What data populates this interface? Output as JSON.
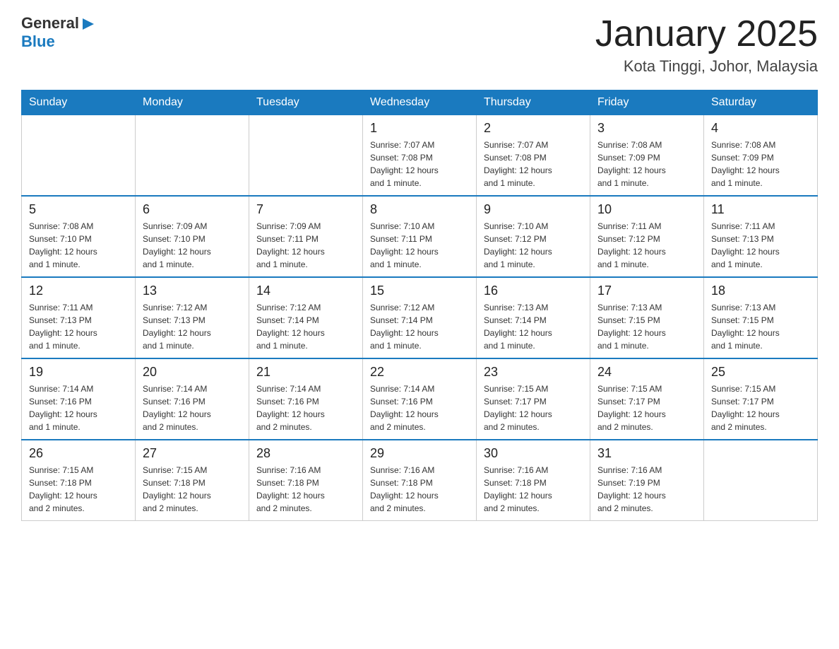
{
  "header": {
    "logo_general": "General",
    "logo_blue": "Blue",
    "title": "January 2025",
    "subtitle": "Kota Tinggi, Johor, Malaysia"
  },
  "columns": [
    "Sunday",
    "Monday",
    "Tuesday",
    "Wednesday",
    "Thursday",
    "Friday",
    "Saturday"
  ],
  "weeks": [
    [
      {
        "day": "",
        "info": ""
      },
      {
        "day": "",
        "info": ""
      },
      {
        "day": "",
        "info": ""
      },
      {
        "day": "1",
        "info": "Sunrise: 7:07 AM\nSunset: 7:08 PM\nDaylight: 12 hours\nand 1 minute."
      },
      {
        "day": "2",
        "info": "Sunrise: 7:07 AM\nSunset: 7:08 PM\nDaylight: 12 hours\nand 1 minute."
      },
      {
        "day": "3",
        "info": "Sunrise: 7:08 AM\nSunset: 7:09 PM\nDaylight: 12 hours\nand 1 minute."
      },
      {
        "day": "4",
        "info": "Sunrise: 7:08 AM\nSunset: 7:09 PM\nDaylight: 12 hours\nand 1 minute."
      }
    ],
    [
      {
        "day": "5",
        "info": "Sunrise: 7:08 AM\nSunset: 7:10 PM\nDaylight: 12 hours\nand 1 minute."
      },
      {
        "day": "6",
        "info": "Sunrise: 7:09 AM\nSunset: 7:10 PM\nDaylight: 12 hours\nand 1 minute."
      },
      {
        "day": "7",
        "info": "Sunrise: 7:09 AM\nSunset: 7:11 PM\nDaylight: 12 hours\nand 1 minute."
      },
      {
        "day": "8",
        "info": "Sunrise: 7:10 AM\nSunset: 7:11 PM\nDaylight: 12 hours\nand 1 minute."
      },
      {
        "day": "9",
        "info": "Sunrise: 7:10 AM\nSunset: 7:12 PM\nDaylight: 12 hours\nand 1 minute."
      },
      {
        "day": "10",
        "info": "Sunrise: 7:11 AM\nSunset: 7:12 PM\nDaylight: 12 hours\nand 1 minute."
      },
      {
        "day": "11",
        "info": "Sunrise: 7:11 AM\nSunset: 7:13 PM\nDaylight: 12 hours\nand 1 minute."
      }
    ],
    [
      {
        "day": "12",
        "info": "Sunrise: 7:11 AM\nSunset: 7:13 PM\nDaylight: 12 hours\nand 1 minute."
      },
      {
        "day": "13",
        "info": "Sunrise: 7:12 AM\nSunset: 7:13 PM\nDaylight: 12 hours\nand 1 minute."
      },
      {
        "day": "14",
        "info": "Sunrise: 7:12 AM\nSunset: 7:14 PM\nDaylight: 12 hours\nand 1 minute."
      },
      {
        "day": "15",
        "info": "Sunrise: 7:12 AM\nSunset: 7:14 PM\nDaylight: 12 hours\nand 1 minute."
      },
      {
        "day": "16",
        "info": "Sunrise: 7:13 AM\nSunset: 7:14 PM\nDaylight: 12 hours\nand 1 minute."
      },
      {
        "day": "17",
        "info": "Sunrise: 7:13 AM\nSunset: 7:15 PM\nDaylight: 12 hours\nand 1 minute."
      },
      {
        "day": "18",
        "info": "Sunrise: 7:13 AM\nSunset: 7:15 PM\nDaylight: 12 hours\nand 1 minute."
      }
    ],
    [
      {
        "day": "19",
        "info": "Sunrise: 7:14 AM\nSunset: 7:16 PM\nDaylight: 12 hours\nand 1 minute."
      },
      {
        "day": "20",
        "info": "Sunrise: 7:14 AM\nSunset: 7:16 PM\nDaylight: 12 hours\nand 2 minutes."
      },
      {
        "day": "21",
        "info": "Sunrise: 7:14 AM\nSunset: 7:16 PM\nDaylight: 12 hours\nand 2 minutes."
      },
      {
        "day": "22",
        "info": "Sunrise: 7:14 AM\nSunset: 7:16 PM\nDaylight: 12 hours\nand 2 minutes."
      },
      {
        "day": "23",
        "info": "Sunrise: 7:15 AM\nSunset: 7:17 PM\nDaylight: 12 hours\nand 2 minutes."
      },
      {
        "day": "24",
        "info": "Sunrise: 7:15 AM\nSunset: 7:17 PM\nDaylight: 12 hours\nand 2 minutes."
      },
      {
        "day": "25",
        "info": "Sunrise: 7:15 AM\nSunset: 7:17 PM\nDaylight: 12 hours\nand 2 minutes."
      }
    ],
    [
      {
        "day": "26",
        "info": "Sunrise: 7:15 AM\nSunset: 7:18 PM\nDaylight: 12 hours\nand 2 minutes."
      },
      {
        "day": "27",
        "info": "Sunrise: 7:15 AM\nSunset: 7:18 PM\nDaylight: 12 hours\nand 2 minutes."
      },
      {
        "day": "28",
        "info": "Sunrise: 7:16 AM\nSunset: 7:18 PM\nDaylight: 12 hours\nand 2 minutes."
      },
      {
        "day": "29",
        "info": "Sunrise: 7:16 AM\nSunset: 7:18 PM\nDaylight: 12 hours\nand 2 minutes."
      },
      {
        "day": "30",
        "info": "Sunrise: 7:16 AM\nSunset: 7:18 PM\nDaylight: 12 hours\nand 2 minutes."
      },
      {
        "day": "31",
        "info": "Sunrise: 7:16 AM\nSunset: 7:19 PM\nDaylight: 12 hours\nand 2 minutes."
      },
      {
        "day": "",
        "info": ""
      }
    ]
  ]
}
